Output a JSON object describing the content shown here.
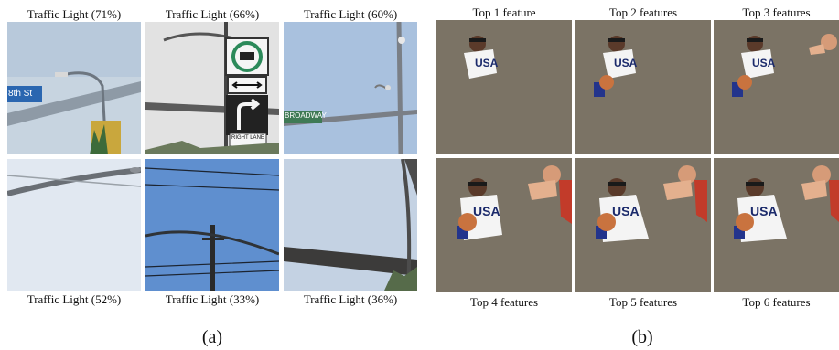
{
  "panel_a": {
    "caption": "(a)",
    "tiles": [
      {
        "label": "Traffic Light (71%)",
        "sign_text": "8th St"
      },
      {
        "label": "Traffic Light (66%)",
        "sign_text": "RIGHT LANE"
      },
      {
        "label": "Traffic Light (60%)",
        "sign_text": "BROADWAY"
      },
      {
        "label": "Traffic Light (52%)"
      },
      {
        "label": "Traffic Light (33%)"
      },
      {
        "label": "Traffic Light (36%)"
      }
    ]
  },
  "panel_b": {
    "caption": "(b)",
    "tiles": [
      {
        "label": "Top 1 feature",
        "jersey_text": "USA"
      },
      {
        "label": "Top 2 features",
        "jersey_text": "USA"
      },
      {
        "label": "Top 3 features",
        "jersey_text": "USA"
      },
      {
        "label": "Top 4 features",
        "jersey_text": "USA"
      },
      {
        "label": "Top 5 features",
        "jersey_text": "USA"
      },
      {
        "label": "Top 6 features",
        "jersey_text": "USA"
      }
    ]
  },
  "colors": {
    "masked_background": "#7b7365",
    "sky_pale": "#d6dfe9",
    "sky_blue": "#5f8fcf",
    "street_sign": "#2a66b0",
    "street_sign_green": "#3f7a55",
    "jersey_red": "#c23b2a",
    "basketball": "#c9733f"
  }
}
